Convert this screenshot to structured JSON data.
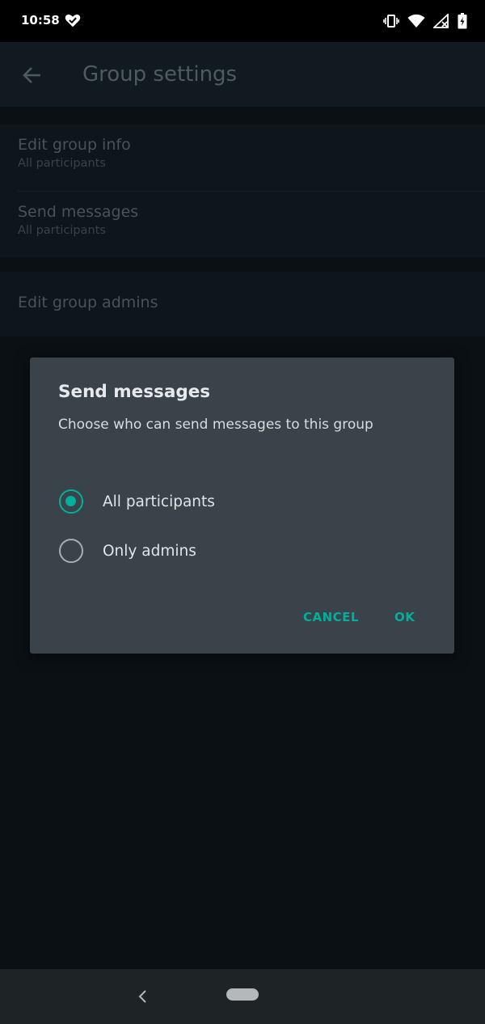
{
  "status_bar": {
    "time": "10:58",
    "icons": [
      "heart-check-icon",
      "vibrate-icon",
      "wifi-icon",
      "signal-icon",
      "battery-icon"
    ]
  },
  "app_bar": {
    "title": "Group settings",
    "back_icon": "arrow-left-icon"
  },
  "settings": {
    "items": [
      {
        "title": "Edit group info",
        "subtitle": "All participants"
      },
      {
        "title": "Send messages",
        "subtitle": "All participants"
      },
      {
        "title": "Edit group admins"
      }
    ]
  },
  "dialog": {
    "title": "Send messages",
    "description": "Choose who can send messages to this group",
    "options": [
      {
        "label": "All participants",
        "selected": true
      },
      {
        "label": "Only admins",
        "selected": false
      }
    ],
    "cancel_label": "CANCEL",
    "ok_label": "OK"
  },
  "colors": {
    "accent": "#00af9c",
    "dialog_bg": "#394349",
    "background": "#0b1014"
  }
}
